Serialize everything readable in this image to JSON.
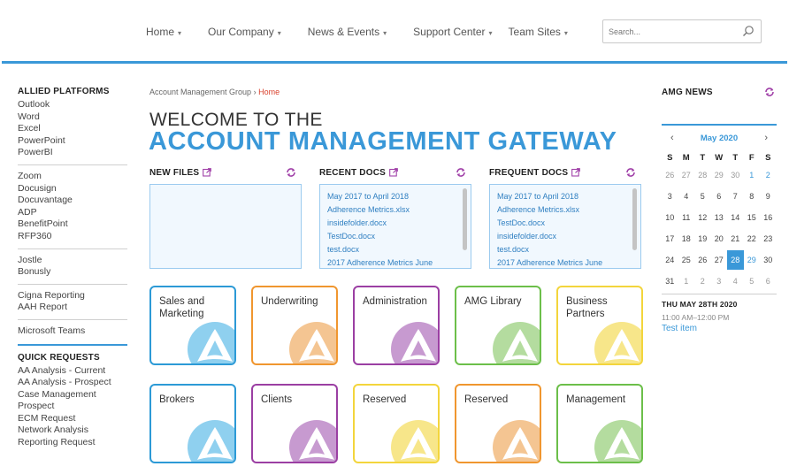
{
  "nav": {
    "items": [
      {
        "label": "Home"
      },
      {
        "label": "Our Company"
      },
      {
        "label": "News & Events"
      },
      {
        "label": "Support Center"
      },
      {
        "label": "Team Sites"
      }
    ],
    "caret": "▾"
  },
  "search": {
    "placeholder": "Search..."
  },
  "left": {
    "allied_title": "ALLIED PLATFORMS",
    "groups": [
      [
        "Outlook",
        "Word",
        "Excel",
        "PowerPoint",
        "PowerBI"
      ],
      [
        "Zoom",
        "Docusign",
        "Docuvantage",
        "ADP",
        "BenefitPoint",
        "RFP360"
      ],
      [
        "Jostle",
        "Bonusly"
      ],
      [
        "Cigna Reporting",
        "AAH Report"
      ],
      [
        "Microsoft Teams"
      ]
    ],
    "quick_title": "QUICK REQUESTS",
    "quick": [
      "AA Analysis - Current",
      "AA Analysis - Prospect",
      "Case Management",
      "Prospect",
      "ECM Request",
      "Network Analysis",
      "Reporting Request"
    ]
  },
  "breadcrumb": {
    "parent": "Account Management Group",
    "sep": " › ",
    "current": "Home"
  },
  "welcome": {
    "line1": "WELCOME TO THE",
    "line2": "ACCOUNT MANAGEMENT GATEWAY"
  },
  "panels": {
    "new_files": {
      "title": "NEW FILES",
      "items": []
    },
    "recent_docs": {
      "title": "RECENT DOCS",
      "items": [
        "May 2017 to April 2018",
        "Adherence Metrics.xlsx",
        "insidefolder.docx",
        "TestDoc.docx",
        "test.docx",
        "2017 Adherence Metrics June"
      ]
    },
    "frequent_docs": {
      "title": "FREQUENT DOCS",
      "items": [
        "May 2017 to April 2018",
        "Adherence Metrics.xlsx",
        "TestDoc.docx",
        "insidefolder.docx",
        "test.docx",
        "2017 Adherence Metrics June"
      ]
    }
  },
  "tiles": {
    "row1": [
      {
        "label": "Sales and Marketing",
        "color": "#2c9ad6",
        "fill": "#8fd0ef"
      },
      {
        "label": "Underwriting",
        "color": "#f0962f",
        "fill": "#f4c592"
      },
      {
        "label": "Administration",
        "color": "#9b3fa3",
        "fill": "#c79ad0"
      },
      {
        "label": "AMG Library",
        "color": "#6cbf4a",
        "fill": "#b4dc9f"
      },
      {
        "label": "Business Partners",
        "color": "#f3d53c",
        "fill": "#f7e68a"
      }
    ],
    "row2": [
      {
        "label": "Brokers",
        "color": "#2c9ad6",
        "fill": "#8fd0ef"
      },
      {
        "label": "Clients",
        "color": "#9b3fa3",
        "fill": "#c79ad0"
      },
      {
        "label": "Reserved",
        "color": "#f3d53c",
        "fill": "#f7e68a"
      },
      {
        "label": "Reserved",
        "color": "#f0962f",
        "fill": "#f4c592"
      },
      {
        "label": "Management",
        "color": "#6cbf4a",
        "fill": "#b4dc9f"
      }
    ]
  },
  "news": {
    "title": "AMG NEWS",
    "calendar": {
      "month": "May 2020",
      "prev": "‹",
      "next": "›",
      "dow": [
        "S",
        "M",
        "T",
        "W",
        "T",
        "F",
        "S"
      ],
      "weeks": [
        [
          "26",
          "27",
          "28",
          "29",
          "30",
          "1",
          "2"
        ],
        [
          "3",
          "4",
          "5",
          "6",
          "7",
          "8",
          "9"
        ],
        [
          "10",
          "11",
          "12",
          "13",
          "14",
          "15",
          "16"
        ],
        [
          "17",
          "18",
          "19",
          "20",
          "21",
          "22",
          "23"
        ],
        [
          "24",
          "25",
          "26",
          "27",
          "28",
          "29",
          "30"
        ],
        [
          "31",
          "1",
          "2",
          "3",
          "4",
          "5",
          "6"
        ]
      ],
      "selected": "28"
    },
    "event": {
      "date": "THU MAY 28TH 2020",
      "time": "11:00 AM–12:00 PM",
      "item": "Test item"
    }
  }
}
